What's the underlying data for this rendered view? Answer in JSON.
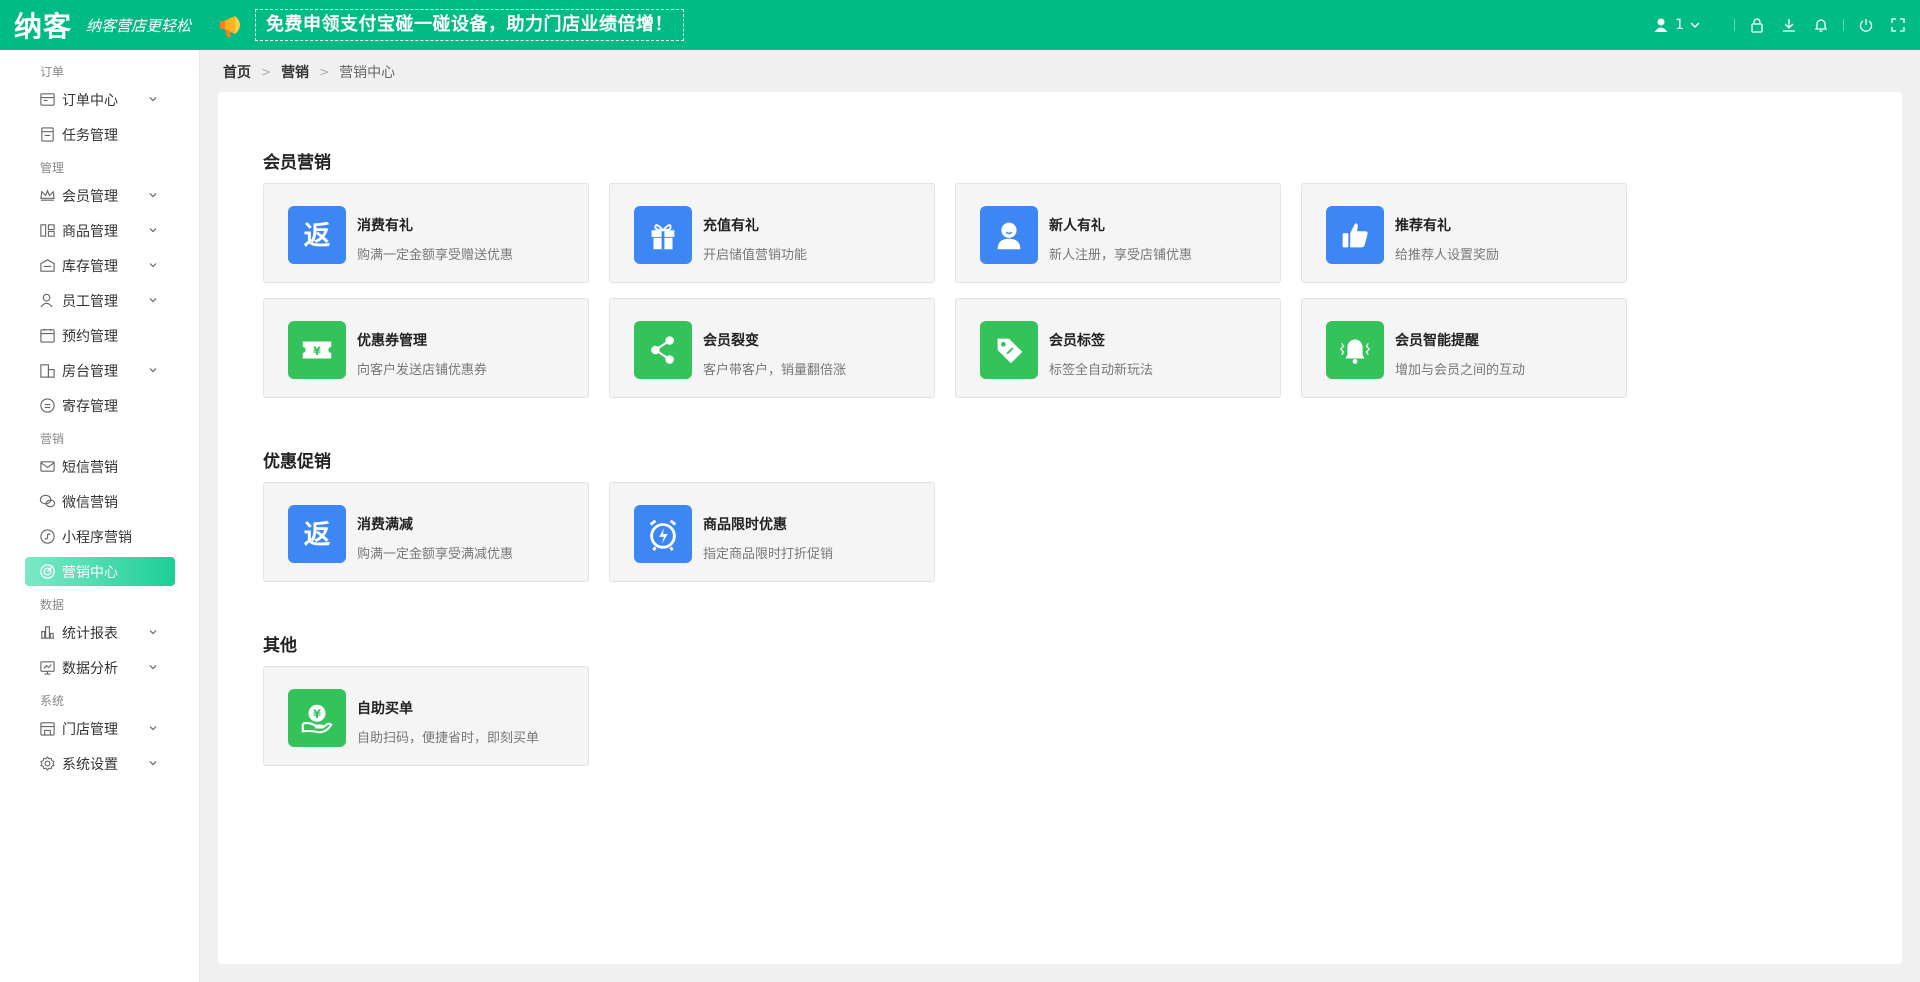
{
  "colors": {
    "brand": "#00bc84",
    "blue_icon": "#3d87f5",
    "green_icon": "#34c25a"
  },
  "header": {
    "logo": "纳客",
    "slogan": "纳客营店更轻松",
    "promo_text": "免费申领支付宝碰一碰设备，助力门店业绩倍增！",
    "user_label": "1",
    "icons": [
      "user-icon",
      "lock-icon",
      "download-icon",
      "bell-icon",
      "power-icon",
      "fullscreen-icon"
    ]
  },
  "sidebar": {
    "groups": {
      "order": "订单",
      "manage": "管理",
      "marketing": "营销",
      "data": "数据",
      "system": "系统"
    },
    "items": {
      "order_center": "订单中心",
      "task_mgmt": "任务管理",
      "member_mgmt": "会员管理",
      "goods_mgmt": "商品管理",
      "stock_mgmt": "库存管理",
      "staff_mgmt": "员工管理",
      "booking_mgmt": "预约管理",
      "room_mgmt": "房台管理",
      "deposit_mgmt": "寄存管理",
      "sms_marketing": "短信营销",
      "wechat_marketing": "微信营销",
      "miniapp_marketing": "小程序营销",
      "marketing_center": "营销中心",
      "report_stats": "统计报表",
      "data_analysis": "数据分析",
      "store_mgmt": "门店管理",
      "system_settings": "系统设置"
    }
  },
  "breadcrumb": {
    "home": "首页",
    "marketing": "营销",
    "current": "营销中心"
  },
  "sections": {
    "member": {
      "title": "会员营销",
      "cards": [
        {
          "title": "消费有礼",
          "desc": "购满一定金额享受赠送优惠",
          "icon": "return-icon"
        },
        {
          "title": "充值有礼",
          "desc": "开启储值营销功能",
          "icon": "gift-icon"
        },
        {
          "title": "新人有礼",
          "desc": "新人注册，享受店铺优惠",
          "icon": "person-icon"
        },
        {
          "title": "推荐有礼",
          "desc": "给推荐人设置奖励",
          "icon": "thumbs-up-icon"
        },
        {
          "title": "优惠券管理",
          "desc": "向客户发送店铺优惠券",
          "icon": "coupon-icon"
        },
        {
          "title": "会员裂变",
          "desc": "客户带客户，销量翻倍涨",
          "icon": "share-icon"
        },
        {
          "title": "会员标签",
          "desc": "标签全自动新玩法",
          "icon": "tag-icon"
        },
        {
          "title": "会员智能提醒",
          "desc": "增加与会员之间的互动",
          "icon": "bell-ring-icon"
        }
      ]
    },
    "promo": {
      "title": "优惠促销",
      "cards": [
        {
          "title": "消费满减",
          "desc": "购满一定金额享受满减优惠",
          "icon": "return-icon"
        },
        {
          "title": "商品限时优惠",
          "desc": "指定商品限时打折促销",
          "icon": "alarm-clock-icon"
        }
      ]
    },
    "other": {
      "title": "其他",
      "cards": [
        {
          "title": "自助买单",
          "desc": "自助扫码，便捷省时，即刻买单",
          "icon": "hand-coin-icon"
        }
      ]
    }
  }
}
